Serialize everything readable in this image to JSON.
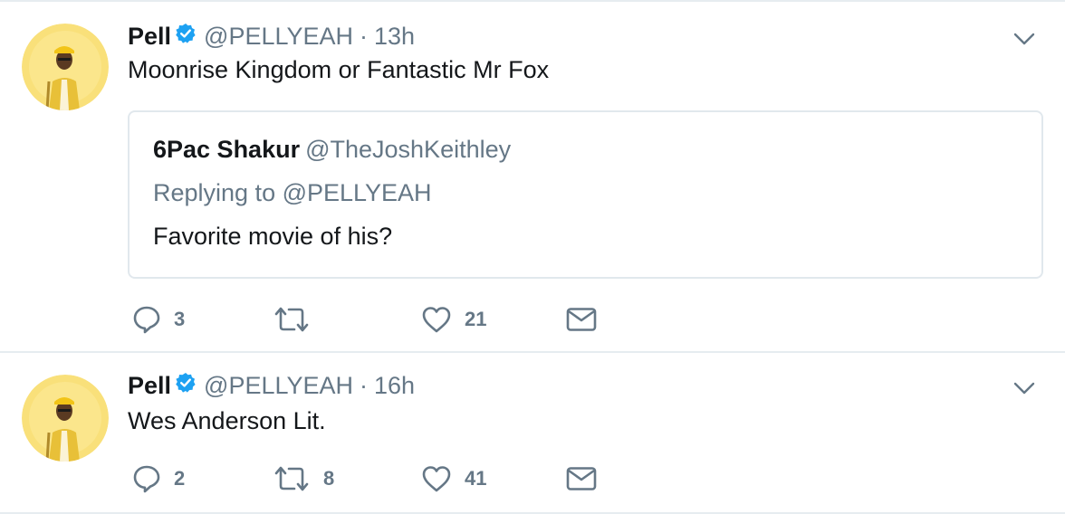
{
  "tweets": [
    {
      "name": "Pell",
      "handle": "@PELLYEAH",
      "separator": "·",
      "time": "13h",
      "text": "Moonrise Kingdom or Fantastic Mr Fox",
      "quote": {
        "name": "6Pac Shakur",
        "handle": "@TheJoshKeithley",
        "replying_to": "Replying to @PELLYEAH",
        "text": "Favorite movie of his?"
      },
      "actions": {
        "replies": "3",
        "retweets": "",
        "likes": "21"
      }
    },
    {
      "name": "Pell",
      "handle": "@PELLYEAH",
      "separator": "·",
      "time": "16h",
      "text": "Wes Anderson Lit.",
      "actions": {
        "replies": "2",
        "retweets": "8",
        "likes": "41"
      }
    }
  ],
  "icons": {
    "verified": "verified-badge-icon",
    "more": "chevron-down-icon",
    "reply": "reply-icon",
    "retweet": "retweet-icon",
    "like": "heart-icon",
    "dm": "envelope-icon"
  },
  "colors": {
    "verified": "#1da1f2",
    "secondary_text": "#657786",
    "avatar_bg": "#f7dc6f",
    "divider": "#e6ecf0"
  }
}
